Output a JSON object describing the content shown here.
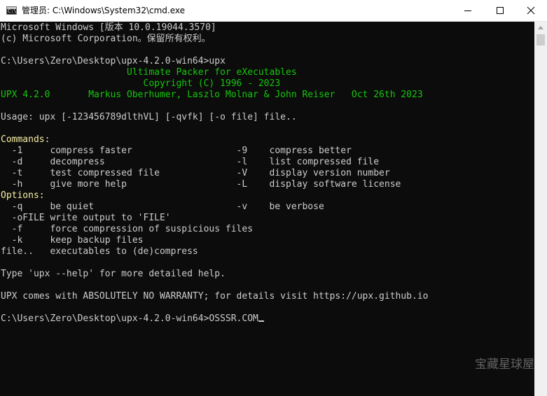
{
  "window": {
    "title": "管理员: C:\\Windows\\System32\\cmd.exe",
    "icon_glyph": "C:\\"
  },
  "colors": {
    "background": "#0c0c0c",
    "text": "#cccccc",
    "green": "#16c60c",
    "yellow": "#f9f1a5",
    "titlebar": "#ffffff"
  },
  "icons": {
    "app": "cmd-icon",
    "minimize": "minimize-icon",
    "maximize": "maximize-icon",
    "close": "close-icon",
    "scroll_up": "chevron-up-icon"
  },
  "console": {
    "lines": [
      "Microsoft Windows [版本 10.0.19044.3570]",
      "(c) Microsoft Corporation。保留所有权利。",
      "",
      "C:\\Users\\Zero\\Desktop\\upx-4.2.0-win64>upx",
      "                       Ultimate Packer for eXecutables",
      "                          Copyright (C) 1996 - 2023",
      "UPX 4.2.0       Markus Oberhumer, Laszlo Molnar & John Reiser   Oct 26th 2023",
      "",
      "Usage: upx [-123456789dlthVL] [-qvfk] [-o file] file..",
      "",
      "Commands:",
      "  -1     compress faster                   -9    compress better",
      "  -d     decompress                        -l    list compressed file",
      "  -t     test compressed file              -V    display version number",
      "  -h     give more help                    -L    display software license",
      "Options:",
      "  -q     be quiet                          -v    be verbose",
      "  -oFILE write output to 'FILE'",
      "  -f     force compression of suspicious files",
      "  -k     keep backup files",
      "file..   executables to (de)compress",
      "",
      "Type 'upx --help' for more detailed help.",
      "",
      "UPX comes with ABSOLUTELY NO WARRANTY; for details visit https://upx.github.io",
      "",
      "C:\\Users\\Zero\\Desktop\\upx-4.2.0-win64>OSSSR.COM"
    ]
  },
  "watermark": "宝藏星球屋"
}
